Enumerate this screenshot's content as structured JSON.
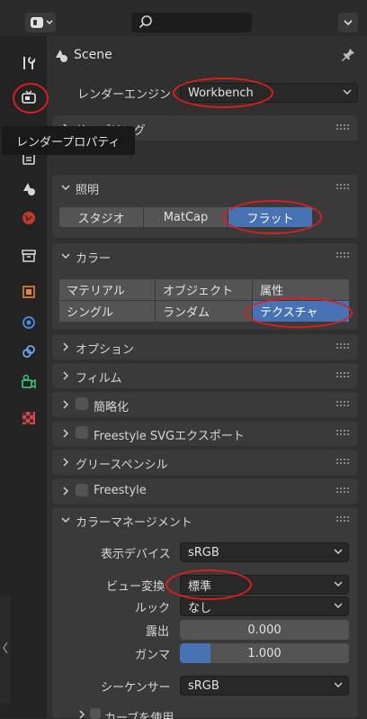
{
  "topbar": {
    "editor_type_icon": "properties-editor-icon",
    "search_placeholder": ""
  },
  "header": {
    "title": "Scene",
    "pin_icon": "pin-icon"
  },
  "render_engine": {
    "label": "レンダーエンジン",
    "value": "Workbench"
  },
  "tooltip": "レンダープロパティ",
  "panels": {
    "sampling": "サンプリング",
    "lighting": "照明",
    "lighting_options": [
      "スタジオ",
      "MatCap",
      "フラット"
    ],
    "lighting_selected": "フラット",
    "color": "カラー",
    "color_options": [
      "マテリアル",
      "オブジェクト",
      "属性",
      "シングル",
      "ランダム",
      "テクスチャ"
    ],
    "color_selected": "テクスチャ",
    "options": "オプション",
    "film": "フィルム",
    "simplify": "簡略化",
    "freestyle_svg": "Freestyle SVGエクスポート",
    "grease_pencil": "グリースペンシル",
    "freestyle": "Freestyle",
    "color_management": "カラーマネージメント",
    "curves": "カーブを使用"
  },
  "color_management": {
    "display_label": "表示デバイス",
    "display_value": "sRGB",
    "view_label": "ビュー変換",
    "view_value": "標準",
    "look_label": "ルック",
    "look_value": "なし",
    "exposure_label": "露出",
    "exposure_value": "0.000",
    "gamma_label": "ガンマ",
    "gamma_value": "1.000",
    "gamma_fraction": 0.18,
    "sequencer_label": "シーケンサー",
    "sequencer_value": "sRGB"
  },
  "colors": {
    "accent": "#4772b3",
    "highlight": "#d81f1f"
  }
}
